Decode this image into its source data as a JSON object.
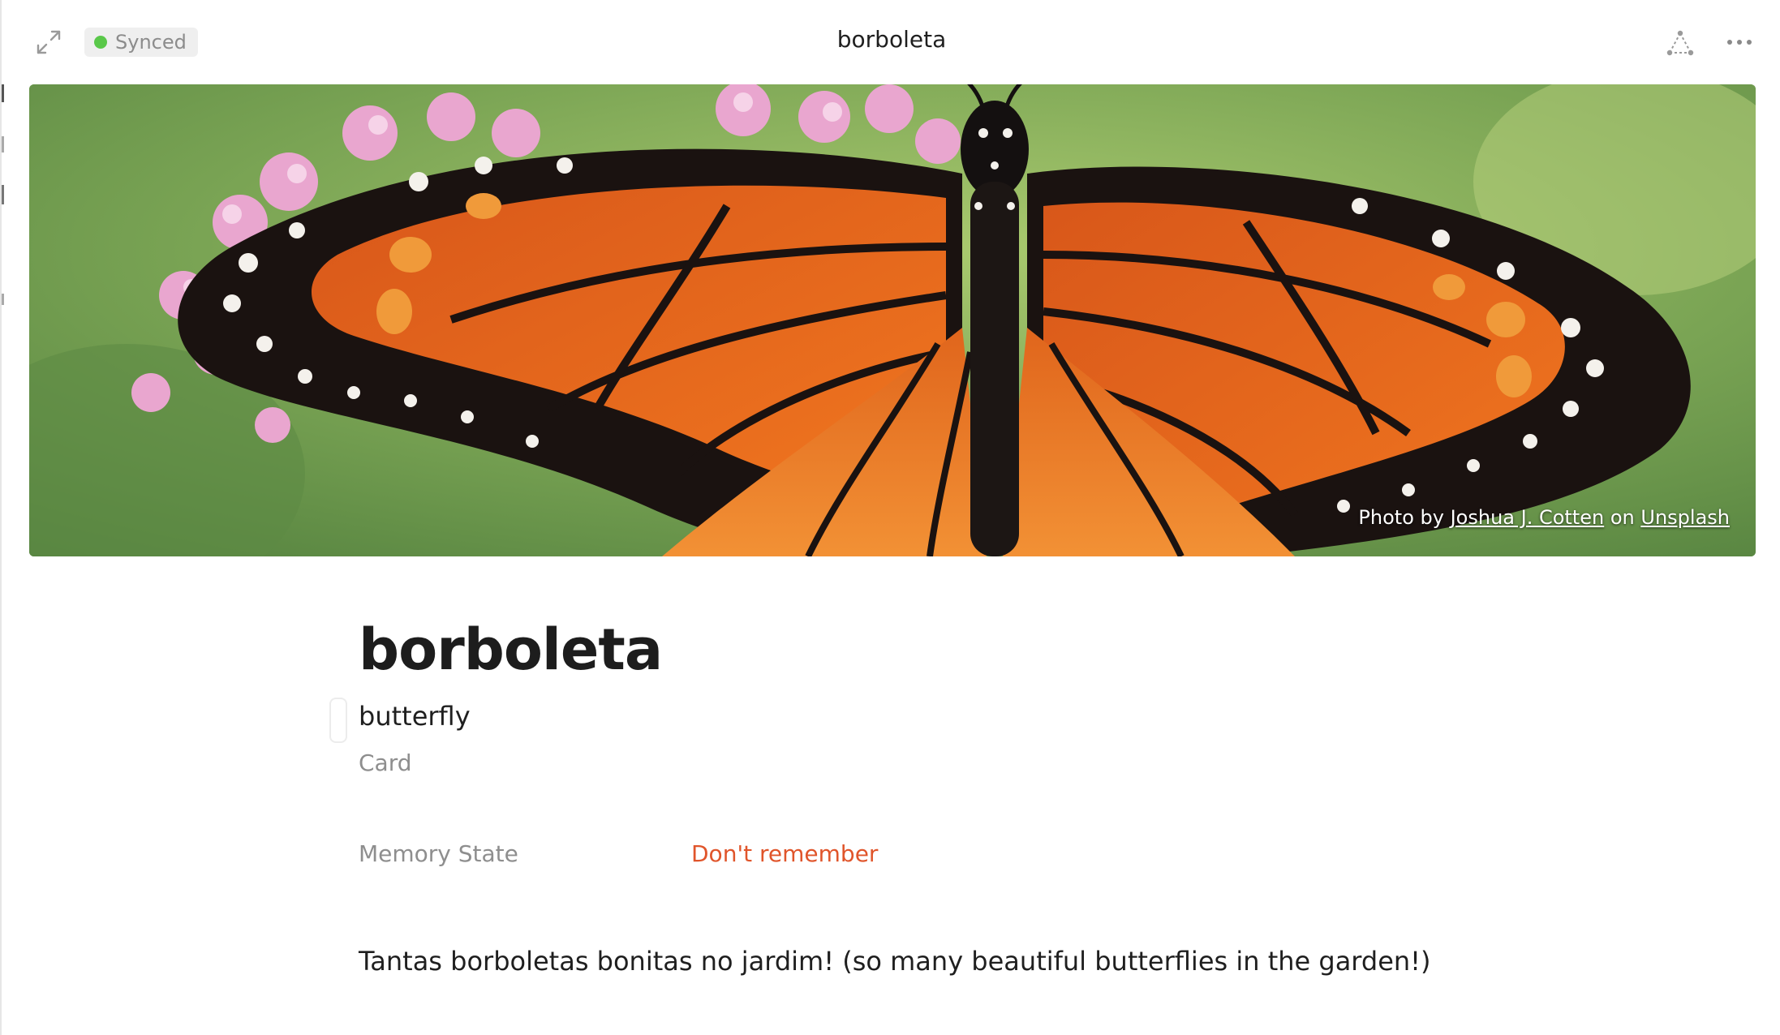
{
  "header": {
    "sync_status": "Synced",
    "title": "borboleta",
    "status_color": "#5ac84a"
  },
  "cover": {
    "credit_prefix": "Photo by",
    "credit_author": "Joshua J. Cotten",
    "credit_mid": "on",
    "credit_source": "Unsplash"
  },
  "page": {
    "title": "borboleta",
    "subtitle": "butterfly",
    "tag": "Card",
    "properties": [
      {
        "label": "Memory State",
        "value": "Don't remember",
        "value_color": "#e0552b"
      }
    ],
    "body": "Tantas borboletas bonitas no jardim! (so many beautiful butterflies in the garden!)"
  },
  "icons": {
    "expand": "expand-icon",
    "graph": "graph-icon",
    "more": "more-icon"
  }
}
